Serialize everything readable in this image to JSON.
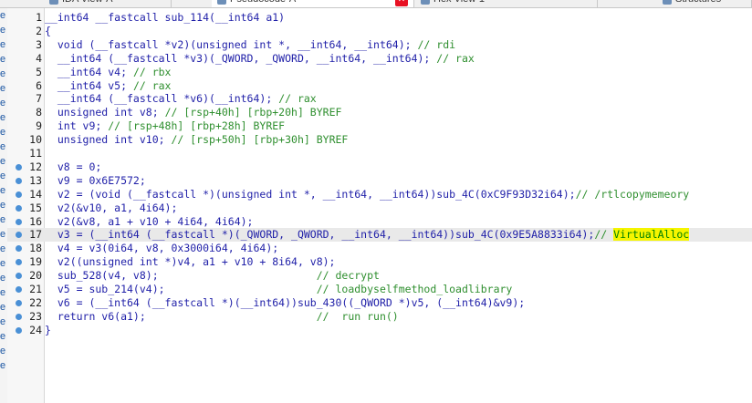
{
  "tabs": [
    {
      "label": "IDA View-A",
      "active": false
    },
    {
      "label": "Pseudocode-A",
      "active": true
    },
    {
      "label": "Hex View-1",
      "active": false
    },
    {
      "label": "Structures",
      "active": false
    }
  ],
  "left_strip_letters": [
    "e",
    "e",
    "e",
    "e",
    "e",
    "e",
    "e",
    "e",
    "e",
    "e",
    "e",
    "e",
    "e",
    "e",
    "e",
    "e",
    "e",
    "e",
    "e",
    "e",
    "e",
    "e",
    "e",
    "e",
    "e"
  ],
  "colors": {
    "highlight": "#f5f500",
    "comment": "#2f8f2f",
    "code": "#1f1fa8",
    "breakpoint": "#4a90d6"
  },
  "code_lines": [
    {
      "num": "1",
      "bp": false,
      "hl": false,
      "code": "__int64 __fastcall sub_114(__int64 a1)",
      "comment": "",
      "mark": "",
      "after": ""
    },
    {
      "num": "2",
      "bp": false,
      "hl": false,
      "code": "{",
      "comment": "",
      "mark": "",
      "after": ""
    },
    {
      "num": "3",
      "bp": false,
      "hl": false,
      "code": "  void (__fastcall *v2)(unsigned int *, __int64, __int64); ",
      "comment": "// rdi",
      "mark": "",
      "after": ""
    },
    {
      "num": "4",
      "bp": false,
      "hl": false,
      "code": "  __int64 (__fastcall *v3)(_QWORD, _QWORD, __int64, __int64); ",
      "comment": "// rax",
      "mark": "",
      "after": ""
    },
    {
      "num": "5",
      "bp": false,
      "hl": false,
      "code": "  __int64 v4; ",
      "comment": "// rbx",
      "mark": "",
      "after": ""
    },
    {
      "num": "6",
      "bp": false,
      "hl": false,
      "code": "  __int64 v5; ",
      "comment": "// rax",
      "mark": "",
      "after": ""
    },
    {
      "num": "7",
      "bp": false,
      "hl": false,
      "code": "  __int64 (__fastcall *v6)(__int64); ",
      "comment": "// rax",
      "mark": "",
      "after": ""
    },
    {
      "num": "8",
      "bp": false,
      "hl": false,
      "code": "  unsigned int v8; ",
      "comment": "// [rsp+40h] [rbp+20h] BYREF",
      "mark": "",
      "after": ""
    },
    {
      "num": "9",
      "bp": false,
      "hl": false,
      "code": "  int v9; ",
      "comment": "// [rsp+48h] [rbp+28h] BYREF",
      "mark": "",
      "after": ""
    },
    {
      "num": "10",
      "bp": false,
      "hl": false,
      "code": "  unsigned int v10; ",
      "comment": "// [rsp+50h] [rbp+30h] BYREF",
      "mark": "",
      "after": ""
    },
    {
      "num": "11",
      "bp": false,
      "hl": false,
      "code": "",
      "comment": "",
      "mark": "",
      "after": ""
    },
    {
      "num": "12",
      "bp": true,
      "hl": false,
      "code": "  v8 = 0;",
      "comment": "",
      "mark": "",
      "after": ""
    },
    {
      "num": "13",
      "bp": true,
      "hl": false,
      "code": "  v9 = 0x6E7572;",
      "comment": "",
      "mark": "",
      "after": ""
    },
    {
      "num": "14",
      "bp": true,
      "hl": false,
      "code": "  v2 = (void (__fastcall *)(unsigned int *, __int64, __int64))sub_4C(0xC9F93D32i64);",
      "comment": "// /rtlcopymemeory",
      "mark": "",
      "after": ""
    },
    {
      "num": "15",
      "bp": true,
      "hl": false,
      "code": "  v2(&v10, a1, 4i64);",
      "comment": "",
      "mark": "",
      "after": ""
    },
    {
      "num": "16",
      "bp": true,
      "hl": false,
      "code": "  v2(&v8, a1 + v10 + 4i64, 4i64);",
      "comment": "",
      "mark": "",
      "after": ""
    },
    {
      "num": "17",
      "bp": true,
      "hl": true,
      "code": "  v3 = (__int64 (__fastcall *)(_QWORD, _QWORD, __int64, __int64))sub_4C(0x9E5A8833i64);",
      "comment": "// ",
      "mark": "VirtualAlloc",
      "after": ""
    },
    {
      "num": "18",
      "bp": true,
      "hl": false,
      "code": "  v4 = v3(0i64, v8, 0x3000i64, 4i64);",
      "comment": "",
      "mark": "",
      "after": ""
    },
    {
      "num": "19",
      "bp": true,
      "hl": false,
      "code": "  v2((unsigned int *)v4, a1 + v10 + 8i64, v8);",
      "comment": "",
      "mark": "",
      "after": ""
    },
    {
      "num": "20",
      "bp": true,
      "hl": false,
      "code": "  sub_528(v4, v8);                         ",
      "comment": "// decrypt",
      "mark": "",
      "after": ""
    },
    {
      "num": "21",
      "bp": true,
      "hl": false,
      "code": "  v5 = sub_214(v4);                        ",
      "comment": "// loadbyselfmethod_loadlibrary",
      "mark": "",
      "after": ""
    },
    {
      "num": "22",
      "bp": true,
      "hl": false,
      "code": "  v6 = (__int64 (__fastcall *)(__int64))sub_430((_QWORD *)v5, (__int64)&v9);",
      "comment": "",
      "mark": "",
      "after": ""
    },
    {
      "num": "23",
      "bp": true,
      "hl": false,
      "code": "  return v6(a1);                           ",
      "comment": "//  run run()",
      "mark": "",
      "after": ""
    },
    {
      "num": "24",
      "bp": true,
      "hl": false,
      "code": "}",
      "comment": "",
      "mark": "",
      "after": ""
    }
  ]
}
